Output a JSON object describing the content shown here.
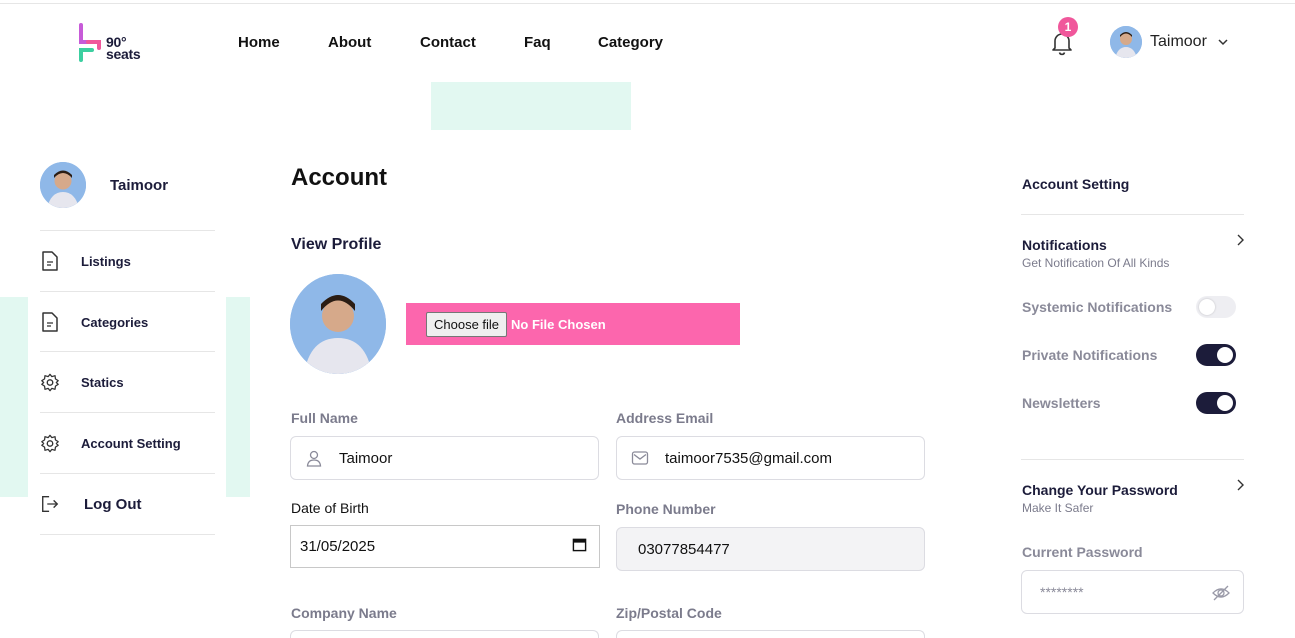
{
  "brand": {
    "logo_text_top": "90°",
    "logo_text_bottom": "seats",
    "accent": "#fc66ad"
  },
  "nav": {
    "items": [
      "Home",
      "About",
      "Contact",
      "Faq",
      "Category"
    ]
  },
  "header": {
    "notification_count": "1",
    "user_name": "Taimoor"
  },
  "sidebar": {
    "user_name": "Taimoor",
    "items": [
      {
        "label": "Listings",
        "icon": "document-icon"
      },
      {
        "label": "Categories",
        "icon": "document-icon"
      },
      {
        "label": "Statics",
        "icon": "gear-icon"
      },
      {
        "label": "Account Setting",
        "icon": "gear-icon"
      },
      {
        "label": "Log Out",
        "icon": "logout-icon"
      }
    ]
  },
  "main": {
    "title": "Account",
    "view_profile": "View Profile",
    "file_button": "Choose file",
    "file_status": "No File Chosen",
    "fields": {
      "full_name": {
        "label": "Full Name",
        "value": "Taimoor"
      },
      "email": {
        "label": "Address Email",
        "value": "taimoor7535@gmail.com"
      },
      "dob": {
        "label": "Date of Birth",
        "value": "31/05/2025"
      },
      "phone": {
        "label": "Phone Number",
        "value": "03077854477"
      },
      "company": {
        "label": "Company Name"
      },
      "zip": {
        "label": "Zip/Postal Code"
      }
    }
  },
  "right_panel": {
    "title": "Account Setting",
    "notifications": {
      "title": "Notifications",
      "subtitle": "Get Notification Of All Kinds"
    },
    "toggles": [
      {
        "label": "Systemic Notifications",
        "on": false
      },
      {
        "label": "Private Notifications",
        "on": true
      },
      {
        "label": "Newsletters",
        "on": true
      }
    ],
    "password": {
      "title": "Change Your Password",
      "subtitle": "Make It Safer",
      "current_label": "Current Password",
      "current_value": "********"
    }
  }
}
